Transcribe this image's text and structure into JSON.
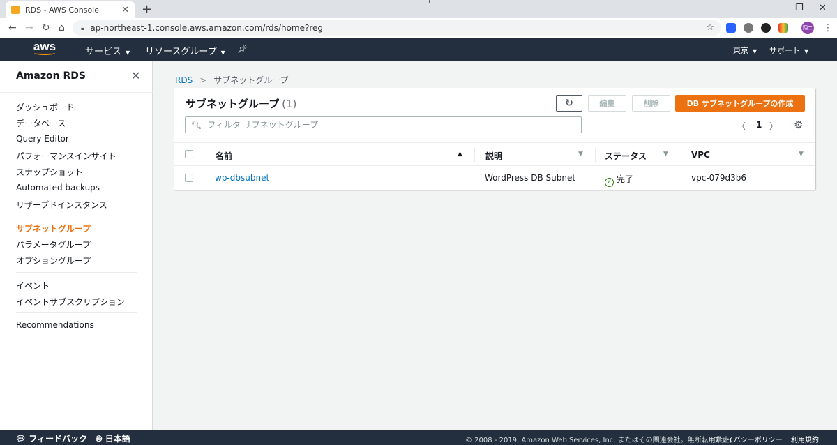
{
  "browser": {
    "tab_title": "RDS - AWS Console",
    "tab_close": "✕",
    "new_tab": "+",
    "window_controls": [
      "—",
      "❐",
      "✕"
    ],
    "url": "ap-northeast-1.console.aws.amazon.com/rds/home?reg",
    "profile_initials": "翔二"
  },
  "aws_nav": {
    "logo": "aws",
    "services": "サービス",
    "resource_groups": "リソースグループ",
    "region": "東京",
    "support": "サポート"
  },
  "sidebar": {
    "title": "Amazon RDS",
    "groups": [
      [
        "ダッシュボード",
        "データベース",
        "Query Editor",
        "パフォーマンスインサイト",
        "スナップショット",
        "Automated backups",
        "リザーブドインスタンス"
      ],
      [
        "サブネットグループ",
        "パラメータグループ",
        "オプショングループ"
      ],
      [
        "イベント",
        "イベントサブスクリプション"
      ],
      [
        "Recommendations"
      ]
    ],
    "active": "サブネットグループ"
  },
  "breadcrumb": {
    "root": "RDS",
    "current": "サブネットグループ"
  },
  "panel": {
    "title": "サブネットグループ",
    "count": "(1)",
    "edit": "編集",
    "delete": "削除",
    "create": "DB サブネットグループの作成",
    "search_placeholder": "フィルタ サブネットグループ",
    "page": "1"
  },
  "table": {
    "columns": [
      "名前",
      "説明",
      "ステータス",
      "VPC"
    ],
    "rows": [
      {
        "name": "wp-dbsubnet",
        "description": "WordPress DB Subnet",
        "status": "完了",
        "vpc": "vpc-079d3b6"
      }
    ]
  },
  "footer": {
    "feedback": "フィードバック",
    "language": "日本語",
    "copyright": "© 2008 - 2019, Amazon Web Services, Inc. またはその関連会社。無断転用禁止。",
    "privacy": "プライバシーポリシー",
    "terms": "利用規約"
  },
  "colors": {
    "nav_bg": "#232f3e",
    "accent": "#ec7211",
    "link": "#0073bb",
    "success": "#1d8102"
  }
}
